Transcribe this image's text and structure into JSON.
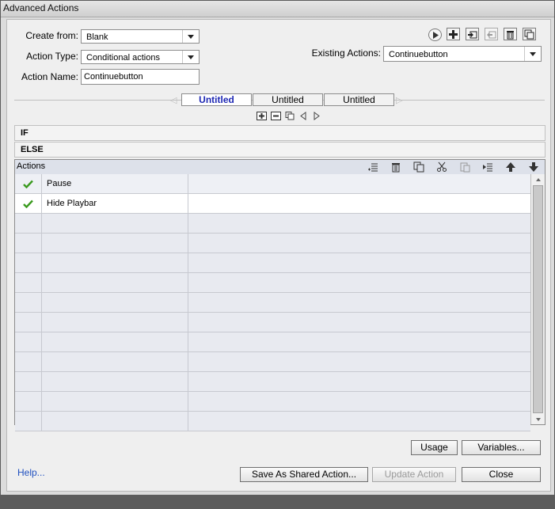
{
  "window": {
    "title": "Advanced Actions"
  },
  "form": {
    "create_from_label": "Create from:",
    "create_from_value": "Blank",
    "action_type_label": "Action Type:",
    "action_type_value": "Conditional actions",
    "action_name_label": "Action Name:",
    "action_name_value": "Continuebutton",
    "existing_actions_label": "Existing Actions:",
    "existing_actions_value": "Continuebutton"
  },
  "toolbar_icons": [
    "play-icon",
    "add-icon",
    "import-icon",
    "export-icon",
    "trash-icon",
    "duplicate-icon"
  ],
  "tabs": [
    {
      "label": "Untitled",
      "active": true
    },
    {
      "label": "Untitled",
      "active": false
    },
    {
      "label": "Untitled",
      "active": false
    }
  ],
  "sections": {
    "if_label": "IF",
    "else_label": "ELSE"
  },
  "actions_grid": {
    "header": "Actions",
    "rows": [
      {
        "status": "check",
        "action": "Pause",
        "target": ""
      },
      {
        "status": "check",
        "action": "Hide Playbar",
        "target": ""
      }
    ],
    "empty_rows": 11
  },
  "buttons": {
    "usage": "Usage",
    "variables": "Variables...",
    "help": "Help...",
    "save_shared": "Save As Shared Action...",
    "update": "Update Action",
    "close": "Close"
  }
}
